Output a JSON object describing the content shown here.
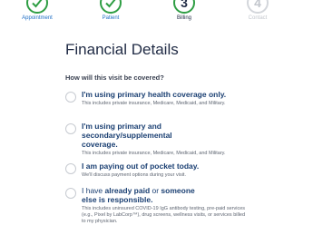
{
  "stepper": {
    "steps": [
      {
        "label": "Appointment",
        "state": "done",
        "number": ""
      },
      {
        "label": "Patient",
        "state": "done",
        "number": ""
      },
      {
        "label": "Billing",
        "state": "current",
        "number": "3"
      },
      {
        "label": "Contact",
        "state": "future",
        "number": "4"
      }
    ]
  },
  "page": {
    "title": "Financial Details",
    "question": "How will this visit be covered?"
  },
  "options": [
    {
      "title": "I'm using primary health coverage only.",
      "desc": "This includes private insurance, Medicare, Medicaid, and Military."
    },
    {
      "title": "I'm using primary and secondary/supplemental coverage.",
      "desc": "This includes private insurance, Medicare, Medicaid, and Military."
    },
    {
      "title": "I am paying out of pocket today.",
      "desc": "We'll discuss payment options during your visit."
    },
    {
      "title_part1": "I have ",
      "title_part2": "already paid",
      "title_part3": " or ",
      "title_part4": "someone else is responsible.",
      "desc": "This includes uninsured COVID-19 IgG antibody testing, pre-paid services (e.g., Pixel by LabCorp™), drug screens, wellness visits, or services billed to my physician."
    }
  ],
  "colors": {
    "green": "#2f9e44",
    "navy": "#1a3f72",
    "link_blue": "#1f6fc5"
  }
}
